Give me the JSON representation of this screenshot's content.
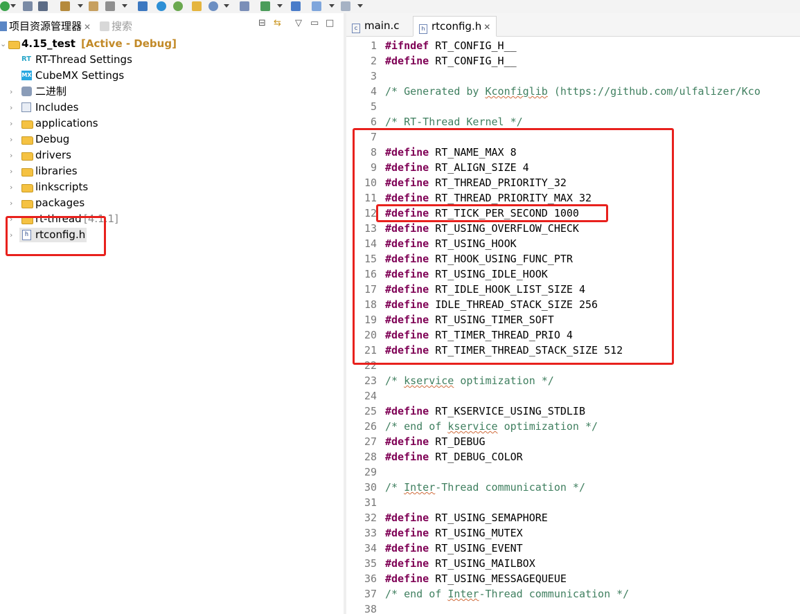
{
  "left_panel": {
    "tabs": [
      {
        "label": "项目资源管理器",
        "close": "✕"
      },
      {
        "label": "搜索"
      }
    ],
    "tree": [
      {
        "label": "4.15_test",
        "suffix": "[Active - Debug]",
        "kind": "project"
      },
      {
        "label": "RT-Thread Settings",
        "kind": "rt"
      },
      {
        "label": "CubeMX Settings",
        "kind": "mx"
      },
      {
        "label": "二进制",
        "kind": "binary"
      },
      {
        "label": "Includes",
        "kind": "includes"
      },
      {
        "label": "applications",
        "kind": "folder"
      },
      {
        "label": "Debug",
        "kind": "folder"
      },
      {
        "label": "drivers",
        "kind": "folder"
      },
      {
        "label": "libraries",
        "kind": "folder"
      },
      {
        "label": "linkscripts",
        "kind": "folder"
      },
      {
        "label": "packages",
        "kind": "folder"
      },
      {
        "label": "rt-thread",
        "suffix": "[4.1.1]",
        "kind": "folder"
      },
      {
        "label": "rtconfig.h",
        "kind": "file"
      }
    ]
  },
  "editor": {
    "tabs": [
      {
        "label": "main.c"
      },
      {
        "label": "rtconfig.h",
        "close": "✕",
        "selected": true
      }
    ],
    "lines": [
      {
        "n": "1",
        "kw": "#ifndef",
        "text": " RT_CONFIG_H__"
      },
      {
        "n": "2",
        "kw": "#define",
        "text": " RT_CONFIG_H__"
      },
      {
        "n": "3",
        "text": ""
      },
      {
        "n": "4",
        "comment_parts": [
          "/* Generated by ",
          "Kconfiglib",
          " (https://github.com/ulfalizer/Kco"
        ]
      },
      {
        "n": "5",
        "text": ""
      },
      {
        "n": "6",
        "comment_parts": [
          "/* RT-Thread Kernel */"
        ]
      },
      {
        "n": "7",
        "text": ""
      },
      {
        "n": "8",
        "kw": "#define",
        "text": " RT_NAME_MAX 8"
      },
      {
        "n": "9",
        "kw": "#define",
        "text": " RT_ALIGN_SIZE 4"
      },
      {
        "n": "10",
        "kw": "#define",
        "text": " RT_THREAD_PRIORITY_32"
      },
      {
        "n": "11",
        "kw": "#define",
        "text": " RT_THREAD_PRIORITY_MAX 32"
      },
      {
        "n": "12",
        "kw": "#define",
        "text": " RT_TICK_PER_SECOND 1000"
      },
      {
        "n": "13",
        "kw": "#define",
        "text": " RT_USING_OVERFLOW_CHECK"
      },
      {
        "n": "14",
        "kw": "#define",
        "text": " RT_USING_HOOK"
      },
      {
        "n": "15",
        "kw": "#define",
        "text": " RT_HOOK_USING_FUNC_PTR"
      },
      {
        "n": "16",
        "kw": "#define",
        "text": " RT_USING_IDLE_HOOK"
      },
      {
        "n": "17",
        "kw": "#define",
        "text": " RT_IDLE_HOOK_LIST_SIZE 4"
      },
      {
        "n": "18",
        "kw": "#define",
        "text": " IDLE_THREAD_STACK_SIZE 256"
      },
      {
        "n": "19",
        "kw": "#define",
        "text": " RT_USING_TIMER_SOFT"
      },
      {
        "n": "20",
        "kw": "#define",
        "text": " RT_TIMER_THREAD_PRIO 4"
      },
      {
        "n": "21",
        "kw": "#define",
        "text": " RT_TIMER_THREAD_STACK_SIZE 512"
      },
      {
        "n": "22",
        "text": ""
      },
      {
        "n": "23",
        "comment_parts": [
          "/* ",
          "kservice",
          " optimization */"
        ]
      },
      {
        "n": "24",
        "text": ""
      },
      {
        "n": "25",
        "kw": "#define",
        "text": " RT_KSERVICE_USING_STDLIB"
      },
      {
        "n": "26",
        "comment_parts": [
          "/* end of ",
          "kservice",
          " optimization */"
        ]
      },
      {
        "n": "27",
        "kw": "#define",
        "text": " RT_DEBUG"
      },
      {
        "n": "28",
        "kw": "#define",
        "text": " RT_DEBUG_COLOR"
      },
      {
        "n": "29",
        "text": ""
      },
      {
        "n": "30",
        "comment_parts": [
          "/* ",
          "Inter",
          "-Thread communication */"
        ]
      },
      {
        "n": "31",
        "text": ""
      },
      {
        "n": "32",
        "kw": "#define",
        "text": " RT_USING_SEMAPHORE"
      },
      {
        "n": "33",
        "kw": "#define",
        "text": " RT_USING_MUTEX"
      },
      {
        "n": "34",
        "kw": "#define",
        "text": " RT_USING_EVENT"
      },
      {
        "n": "35",
        "kw": "#define",
        "text": " RT_USING_MAILBOX"
      },
      {
        "n": "36",
        "kw": "#define",
        "text": " RT_USING_MESSAGEQUEUE"
      },
      {
        "n": "37",
        "comment_parts": [
          "/* end of ",
          "Inter",
          "-Thread communication */"
        ]
      },
      {
        "n": "38",
        "text": ""
      }
    ]
  },
  "colors": {
    "keyword": "#7f0055",
    "comment": "#3f7f5f",
    "annotation_red": "#e8211d",
    "active_config": "#c28a28"
  }
}
